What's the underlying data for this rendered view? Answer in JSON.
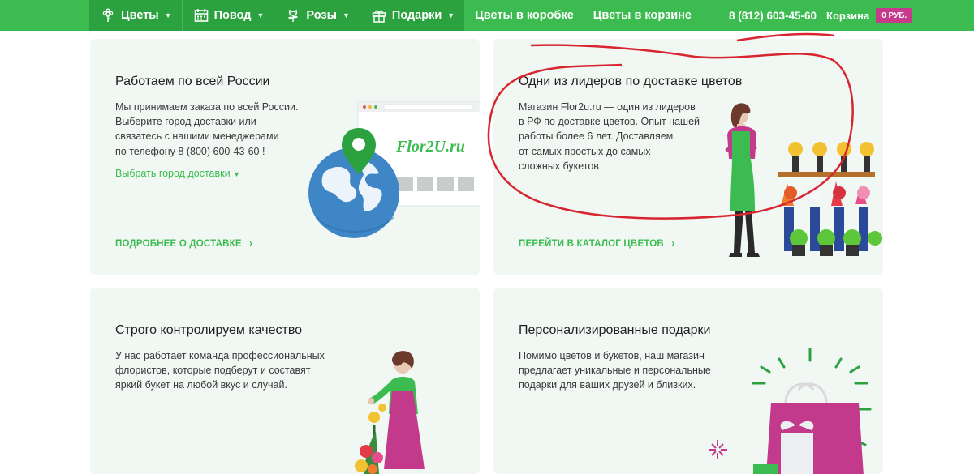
{
  "nav": {
    "menu": [
      {
        "label": "Цветы",
        "icon": "flower-icon"
      },
      {
        "label": "Повод",
        "icon": "calendar-icon"
      },
      {
        "label": "Розы",
        "icon": "rose-icon"
      },
      {
        "label": "Подарки",
        "icon": "gift-icon"
      }
    ],
    "links": [
      "Цветы в коробке",
      "Цветы в корзине"
    ],
    "phone": "8 (812) 603-45-60",
    "cart_label": "Корзина",
    "cart_badge": "0 РУБ."
  },
  "cards": {
    "delivery": {
      "title": "Работаем по всей России",
      "text": [
        "Мы принимаем заказа по всей России.",
        "Выберите город доставки или",
        "связатесь с нашими менеджерами",
        "по телефону 8 (800) 600-43-60 !"
      ],
      "select_city": "Выбрать город доставки",
      "more": "ПОДРОБНЕЕ О ДОСТАВКЕ",
      "logo_text": "Flor2U.ru"
    },
    "leaders": {
      "title": "Одни из лидеров по доставке цветов",
      "text": [
        "Магазин Flor2u.ru — один из лидеров",
        "в РФ по доставке цветов. Опыт нашей",
        "работы более 6 лет. Доставляем",
        "от самых простых до самых",
        "сложных букетов"
      ],
      "more": "ПЕРЕЙТИ В КАТАЛОГ ЦВЕТОВ"
    },
    "quality": {
      "title": "Строго контролируем качество",
      "text": [
        "У нас работает команда профессиональных",
        "флористов, которые подберут и составят",
        "яркий букет на любой вкус и случай."
      ]
    },
    "gifts": {
      "title": "Персонализированные подарки",
      "text": [
        "Помимо цветов и букетов, наш магазин",
        "предлагает уникальные и персональные",
        "подарки для ваших друзей и близких."
      ]
    }
  },
  "colors": {
    "brand_green": "#3cbc50",
    "dark_green": "#2ba13f",
    "badge": "#c63a8c",
    "card_bg": "#f1f7f3",
    "annotation_red": "#d7262f"
  }
}
